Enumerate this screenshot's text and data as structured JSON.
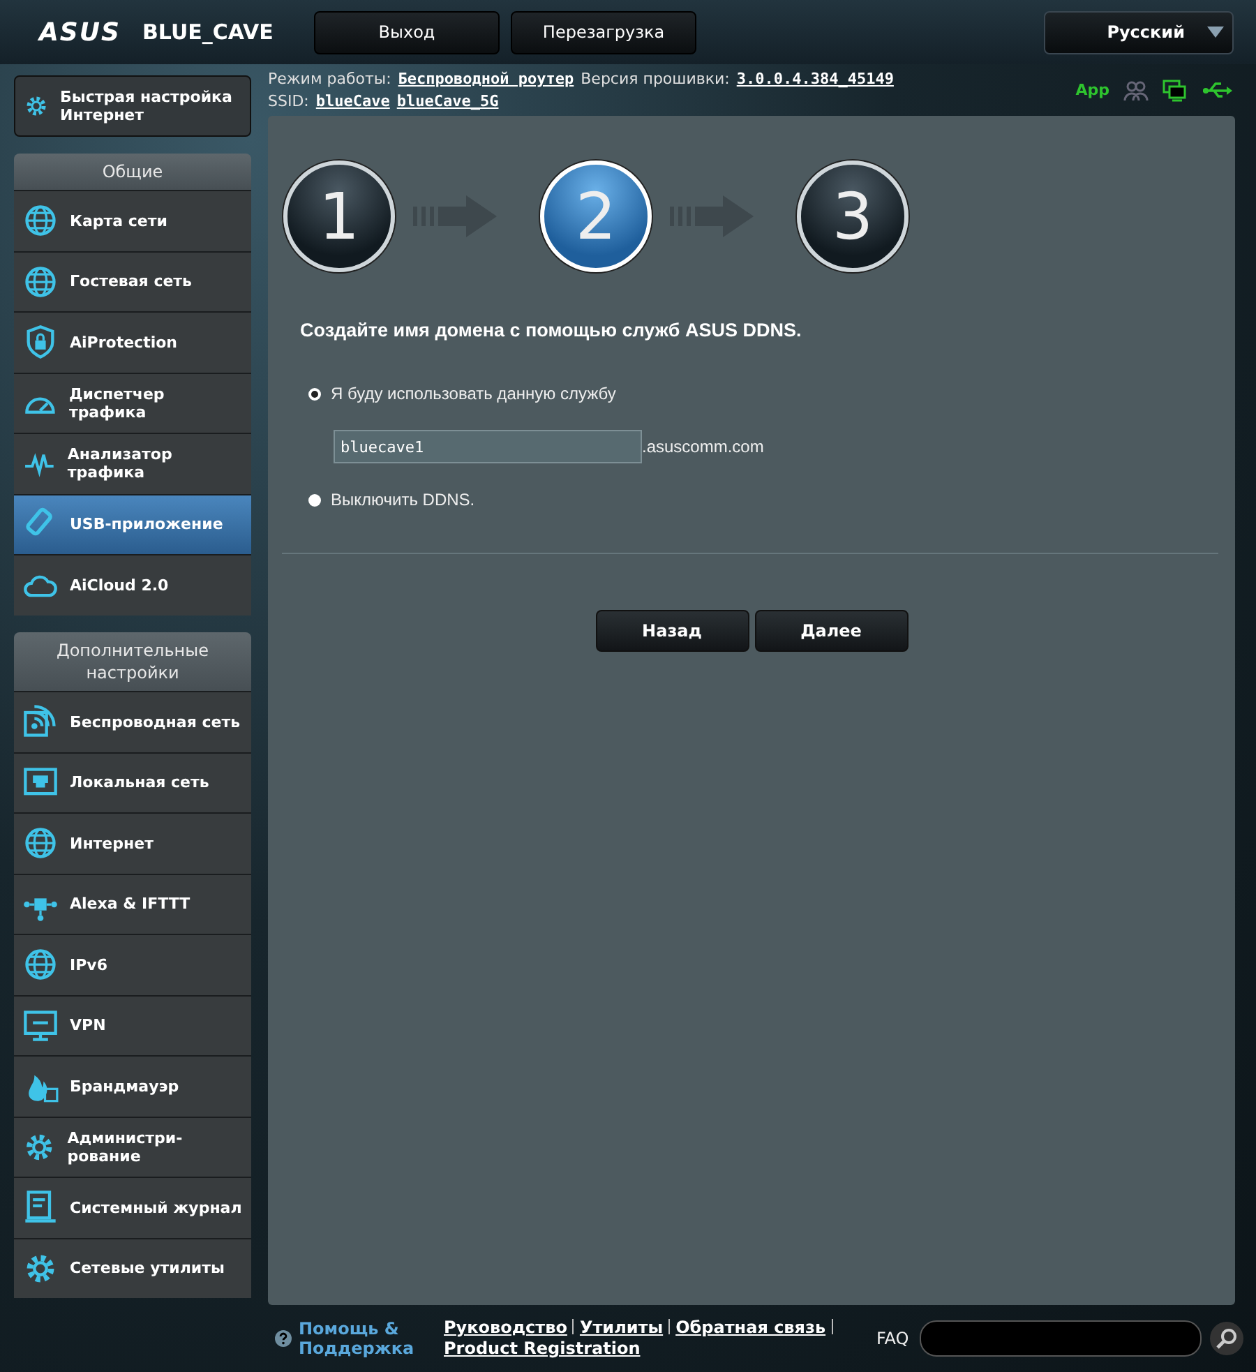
{
  "header": {
    "logo": "ASUS",
    "model": "BLUE_CAVE",
    "buttons": [
      "Выход",
      "Перезагрузка"
    ],
    "language": "Русский"
  },
  "info": {
    "mode_label": "Режим работы:",
    "mode": "Беспроводной роутер",
    "firmware_label": "Версия прошивки:",
    "firmware": "3.0.0.4.384_45149",
    "ssid_label": "SSID:",
    "ssids": [
      "blueCave",
      "blueCave_5G"
    ],
    "app_label": "App"
  },
  "sidebar": {
    "quick_setup": "Быстрая настройка Интернет",
    "sections": [
      {
        "title": "Общие",
        "items": [
          {
            "label": "Карта сети",
            "selected": false
          },
          {
            "label": "Гостевая сеть",
            "selected": false
          },
          {
            "label": "AiProtection",
            "selected": false
          },
          {
            "label": "Диспетчер трафика",
            "selected": false
          },
          {
            "label": "Анализатор трафика",
            "selected": false
          },
          {
            "label": "USB-приложение",
            "selected": true
          },
          {
            "label": "AiCloud 2.0",
            "selected": false
          }
        ]
      },
      {
        "title": "Дополнительные настройки",
        "items": [
          {
            "label": "Беспроводная сеть",
            "selected": false
          },
          {
            "label": "Локальная сеть",
            "selected": false
          },
          {
            "label": "Интернет",
            "selected": false
          },
          {
            "label": "Alexa & IFTTT",
            "selected": false
          },
          {
            "label": "IPv6",
            "selected": false
          },
          {
            "label": "VPN",
            "selected": false
          },
          {
            "label": "Брандмауэр",
            "selected": false
          },
          {
            "label": "Администри-рование",
            "selected": false
          },
          {
            "label": "Системный журнал",
            "selected": false
          },
          {
            "label": "Сетевые утилиты",
            "selected": false
          }
        ]
      }
    ]
  },
  "wizard": {
    "steps": [
      {
        "number": "1",
        "selected": false
      },
      {
        "number": "2",
        "selected": true
      },
      {
        "number": "3",
        "selected": false
      }
    ],
    "heading": "Создайте имя домена с помощью служб ASUS DDNS.",
    "options": [
      {
        "label": "Я буду использовать данную службу",
        "selected": true
      },
      {
        "label": "Выключить DDNS.",
        "selected": false
      }
    ],
    "hostname": {
      "value": "bluecave1",
      "suffix": ".asuscomm.com"
    },
    "buttons": [
      "Назад",
      "Далее"
    ]
  },
  "footer": {
    "help": "Помощь & Поддержка",
    "links": [
      "Руководство",
      "Утилиты",
      "Обратная связь",
      "Product Registration"
    ],
    "faq": "FAQ"
  }
}
